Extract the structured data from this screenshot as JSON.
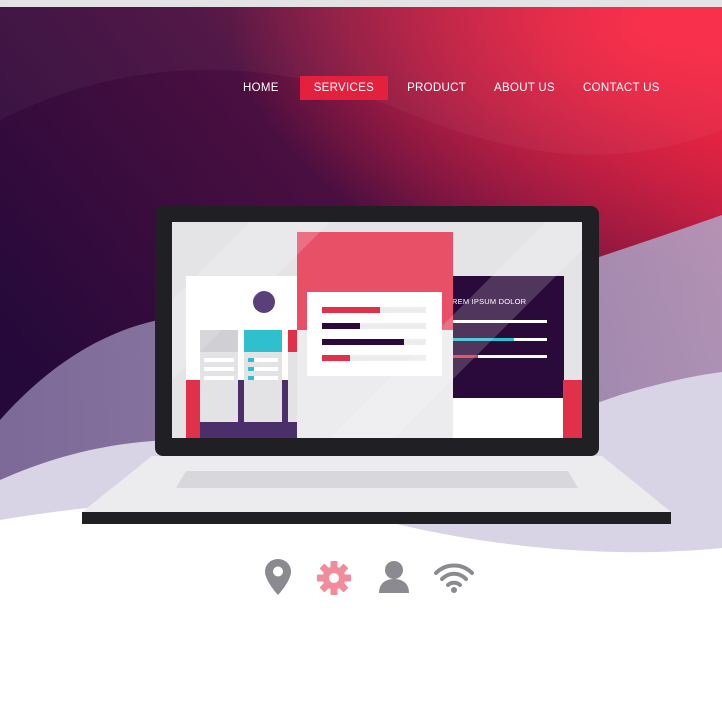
{
  "nav": {
    "items": [
      {
        "label": "HOME"
      },
      {
        "label": "SERVICES",
        "active": true
      },
      {
        "label": "PRODUCT"
      },
      {
        "label": "ABOUT US"
      },
      {
        "label": "CONTACT US"
      }
    ]
  },
  "screen": {
    "panel_heading": "OREM IPSUM DOLOR"
  },
  "icons": [
    "location-pin-icon",
    "gear-icon",
    "user-icon",
    "wifi-icon"
  ],
  "colors": {
    "accent": "#e4203f",
    "dark_purple": "#2a0a3a",
    "lavender": "#c6bdd8",
    "icon_gray": "#8a8a90",
    "icon_pink": "#f08c9c"
  }
}
